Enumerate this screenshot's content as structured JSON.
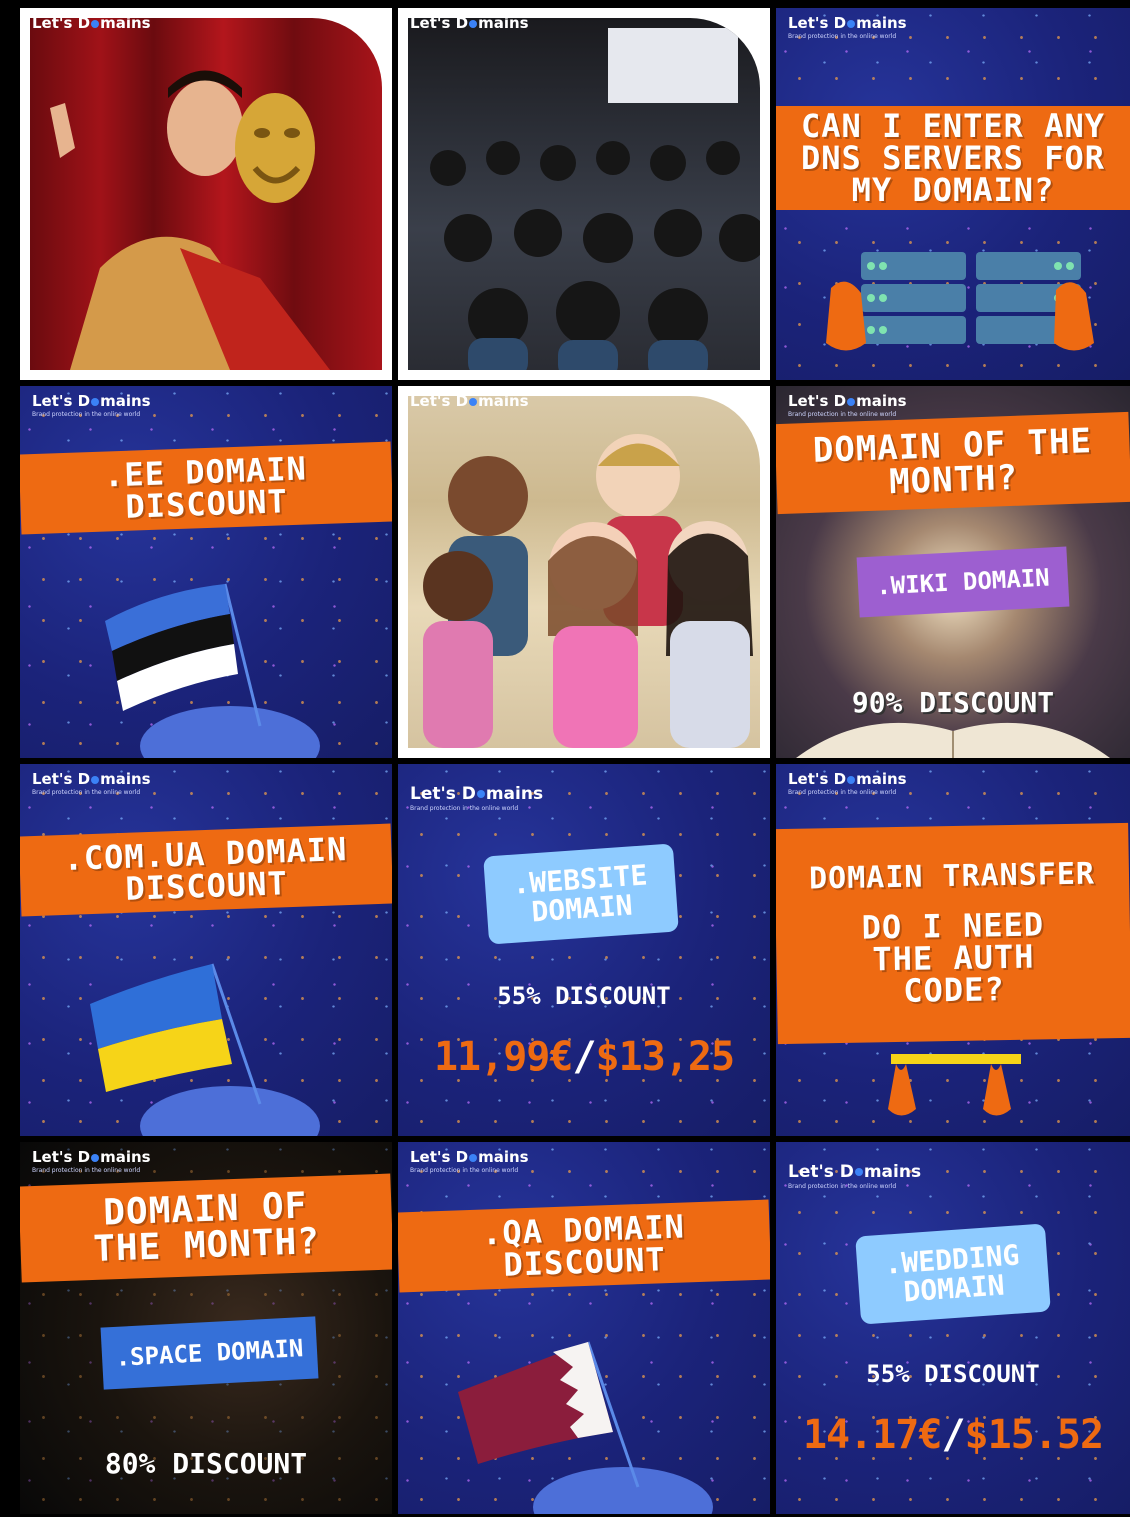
{
  "brand": {
    "name_part1": "Let's D",
    "name_part2": "mains",
    "tagline": "Brand protection in the online world"
  },
  "tiles": {
    "t3": {
      "headline": "CAN I ENTER ANY DNS SERVERS FOR MY DOMAIN?"
    },
    "t4": {
      "headline": ".EE DOMAIN DISCOUNT"
    },
    "t6": {
      "headline": "DOMAIN OF THE MONTH?",
      "domain": ".WIKI DOMAIN",
      "discount": "90% DISCOUNT"
    },
    "t7": {
      "headline": ".COM.UA DOMAIN DISCOUNT"
    },
    "t8": {
      "domain": ".WEBSITE DOMAIN",
      "discount": "55% DISCOUNT",
      "price_eur": "11,99€",
      "price_sep": "/",
      "price_usd": "$13,25"
    },
    "t9": {
      "headline": "DOMAIN TRANSFER",
      "subheadline": "DO I NEED THE AUTH CODE?"
    },
    "t10": {
      "headline": "DOMAIN OF THE MONTH?",
      "domain": ".SPACE DOMAIN",
      "discount": "80% DISCOUNT"
    },
    "t11": {
      "headline": ".QA DOMAIN DISCOUNT"
    },
    "t12": {
      "domain": ".WEDDING DOMAIN",
      "discount": "55% DISCOUNT",
      "price_eur": "14.17€",
      "price_sep": "/",
      "price_usd": "$15.52"
    }
  },
  "colors": {
    "navy": "#1e2a86",
    "orange": "#ee6a12",
    "light_blue": "#8ecbff",
    "purple": "#9d5fd0",
    "blue": "#3570d8"
  }
}
